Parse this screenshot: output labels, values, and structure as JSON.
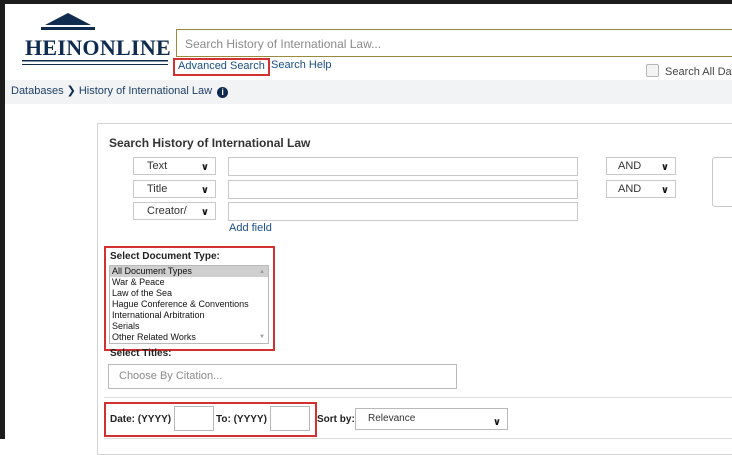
{
  "header": {
    "logo_text": "HEINONLINE",
    "search_placeholder": "Search History of International Law...",
    "advanced_search_label": "Advanced Search",
    "search_help_label": "Search Help",
    "search_all_label": "Search All Databa"
  },
  "breadcrumb": {
    "root": "Databases",
    "current": "History of International Law"
  },
  "form": {
    "title": "Search History of International Law",
    "field_rows": [
      {
        "field": "Text",
        "bool": "AND"
      },
      {
        "field": "Title",
        "bool": "AND"
      },
      {
        "field": "Creator/"
      }
    ],
    "add_field_label": "Add field",
    "doc_type_label": "Select Document Type:",
    "doc_types": [
      "All Document Types",
      "War & Peace",
      "Law of the Sea",
      "Hague Conference & Conventions",
      "International Arbitration",
      "Serials",
      "Other Related Works"
    ],
    "selected_doc_type": "All Document Types",
    "titles_label": "Select Titles:",
    "citation_placeholder": "Choose By Citation...",
    "date_from_label": "Date: (YYYY)",
    "date_to_label": "To: (YYYY)",
    "sort_by_label": "Sort by:",
    "sort_value": "Relevance"
  },
  "colors": {
    "highlight_red": "#d33030",
    "link_blue": "#1a4f87",
    "brand_navy": "#0f2b4f"
  }
}
